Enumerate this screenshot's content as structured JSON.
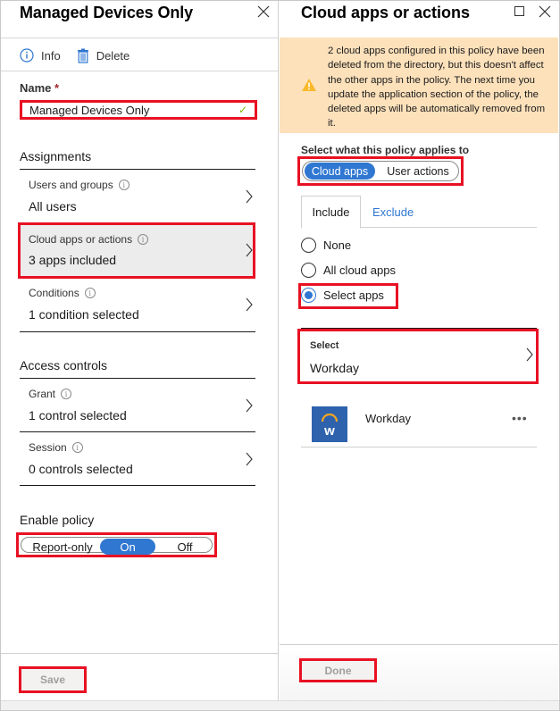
{
  "left_blade": {
    "title": "Managed Devices Only",
    "toolbar": {
      "info_label": "Info",
      "delete_label": "Delete"
    },
    "name_field": {
      "label": "Name",
      "required_mark": "*",
      "value": "Managed Devices Only",
      "valid_icon": "✓"
    },
    "assignments": {
      "heading": "Assignments",
      "items": [
        {
          "label": "Users and groups",
          "value": "All users"
        },
        {
          "label": "Cloud apps or actions",
          "value": "3 apps included",
          "selected": true
        },
        {
          "label": "Conditions",
          "value": "1 condition selected"
        }
      ]
    },
    "access_controls": {
      "heading": "Access controls",
      "items": [
        {
          "label": "Grant",
          "value": "1 control selected"
        },
        {
          "label": "Session",
          "value": "0 controls selected"
        }
      ]
    },
    "enable_policy": {
      "heading": "Enable policy",
      "options": [
        "Report-only",
        "On",
        "Off"
      ],
      "selected": "On"
    },
    "save_label": "Save"
  },
  "right_blade": {
    "title": "Cloud apps or actions",
    "warning": "2 cloud apps configured in this policy have been deleted from the directory, but this doesn't affect the other apps in the policy. The next time you update the application section of the policy, the deleted apps will be automatically removed from it.",
    "applies_label": "Select what this policy applies to",
    "applies_options": [
      "Cloud apps",
      "User actions"
    ],
    "applies_selected": "Cloud apps",
    "tabs": [
      {
        "label": "Include",
        "active": true
      },
      {
        "label": "Exclude",
        "active": false
      }
    ],
    "radios": [
      {
        "label": "None",
        "checked": false
      },
      {
        "label": "All cloud apps",
        "checked": false
      },
      {
        "label": "Select apps",
        "checked": true
      }
    ],
    "select": {
      "label": "Select",
      "value": "Workday"
    },
    "apps": [
      {
        "name": "Workday",
        "logo_letter": "w",
        "more": "•••"
      }
    ],
    "done_label": "Done"
  },
  "colors": {
    "accent": "#2f77d1",
    "highlight_border": "#e81123",
    "warning_bg": "#fce1bb",
    "warning_icon": "#f8b92a",
    "workday_blue": "#2e62ad",
    "workday_arc": "#f5a623",
    "valid_check": "#7fba00"
  }
}
